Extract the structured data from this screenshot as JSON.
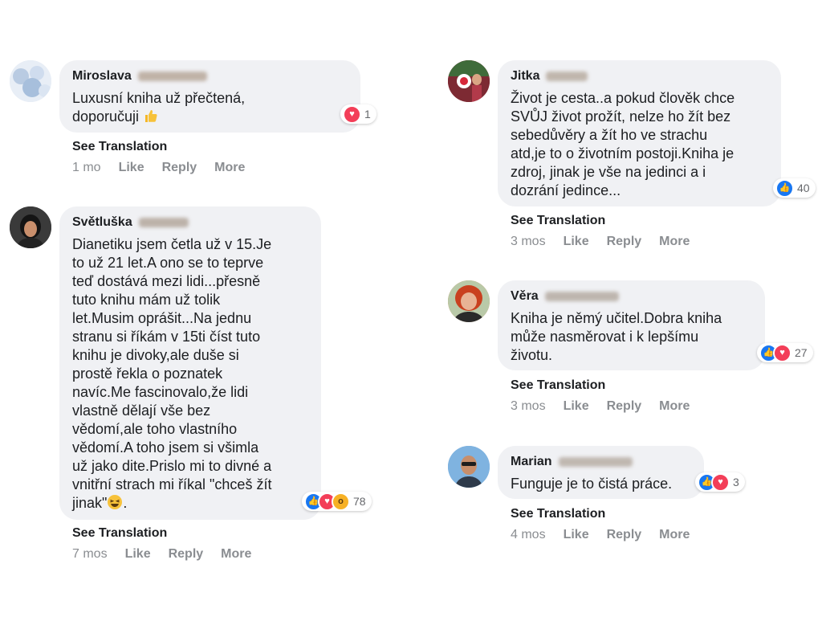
{
  "comments": [
    {
      "name": "Miroslava",
      "text": "Luxusní kniha už přečtená,\ndoporučuji",
      "reaction_count": "1",
      "see_translation": "See Translation",
      "time": "1 mo",
      "like": "Like",
      "reply": "Reply",
      "more": "More"
    },
    {
      "name": "Světluška",
      "text": "Dianetiku jsem četla už v 15.Je\nto už 21 let.A ono se to teprve\nteď dostává mezi lidi...přesně\ntuto knihu mám už tolik\nlet.Musim oprášit...Na jednu\nstranu si říkám v 15ti číst tuto\nknihu je divoky,ale duše si\nprostě řekla o poznatek\nnavíc.Me fascinovalo,že lidi\nvlastně dělají vše bez\nvědomí,ale toho vlastního\nvědomí.A toho jsem si všimla\nuž jako dite.Prislo mi to divné a\nvnitřní strach mi říkal \"chceš žít\njinak\"",
      "text_suffix": ".",
      "reaction_count": "78",
      "see_translation": "See Translation",
      "time": "7 mos",
      "like": "Like",
      "reply": "Reply",
      "more": "More"
    },
    {
      "name": "Jitka",
      "text": "Život je cesta..a pokud člověk chce\nSVŮJ život prožít, nelze ho žít bez\nsebedůvěry a žít ho ve strachu\natd,je to o životním postoji.Kniha je\nzdroj, jinak je vše na jedinci a i\ndozrání jedince...",
      "reaction_count": "40",
      "see_translation": "See Translation",
      "time": "3 mos",
      "like": "Like",
      "reply": "Reply",
      "more": "More"
    },
    {
      "name": "Věra",
      "text": "Kniha je němý učitel.Dobra kniha\nmůže nasměrovat i k lepšímu\nživotu.",
      "reaction_count": "27",
      "see_translation": "See Translation",
      "time": "3 mos",
      "like": "Like",
      "reply": "Reply",
      "more": "More"
    },
    {
      "name": "Marian",
      "text": "Funguje je to čistá práce.",
      "reaction_count": "3",
      "see_translation": "See Translation",
      "time": "4 mos",
      "like": "Like",
      "reply": "Reply",
      "more": "More"
    }
  ],
  "colors": {
    "bubble": "#f0f1f4",
    "like_blue": "#1877f2",
    "love_red": "#f33e58",
    "wow_yellow": "#f7b125",
    "meta_gray": "#8a8d91",
    "text": "#1c1e21"
  }
}
